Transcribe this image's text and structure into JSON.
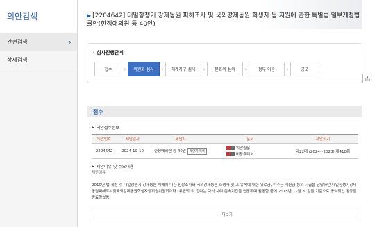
{
  "sidebar": {
    "title": "의안검색",
    "items": [
      {
        "label": "간편검색",
        "chevron": "›"
      },
      {
        "label": "상세검색"
      }
    ]
  },
  "bill": {
    "title": "[2204642] 대일항쟁기 강제동원 피해조사 및 국외강제동원 희생자 등 지원에 관한 특별법 일부개정법률안(한정애의원 등 40인)"
  },
  "stages": {
    "title": "심사진행단계",
    "items": [
      "접수",
      "위원회 심사",
      "체계자구 심사",
      "본회의 심의",
      "정부 이송",
      "공포"
    ],
    "active_index": 1
  },
  "top_button": {
    "line1": "▲",
    "line2": "TOP"
  },
  "section": {
    "title": "접수"
  },
  "receipt_info": {
    "label": "의안접수정보",
    "headers": [
      "의안번호",
      "제안일자",
      "제안자",
      "문서",
      "제안회기"
    ],
    "row": {
      "bill_no": "2204642",
      "date": "2024-10-10",
      "proposer": "한정애의원 등 40인",
      "proposer_btn": "제안자 목록",
      "docs": [
        "의안원문",
        "비용추계서"
      ],
      "session": "제22대 (2024~2028) 제418회"
    }
  },
  "reason": {
    "label": "제안이유 및 주요내용",
    "sublabel": "제안이유",
    "text": "2010년 법 제정 후 대일항쟁기 강제동원 피해에 대한 진상조사와 국외강제동원 희생자 및 그 유족에 대한 위로금, 미수금 지원금 등의 지급을 담당하던 대일항쟁기강제동원피해조사및국외강제동원희생자등지원위원회이하 \"위원회\"라 한다는 다섯 차례 존속기간을 연장하며 활동한 끝에 2015년 12월 31일을 기준으로 공식적인 활동을 종료하였음."
  },
  "more_button": {
    "label": "+ 더보기"
  }
}
